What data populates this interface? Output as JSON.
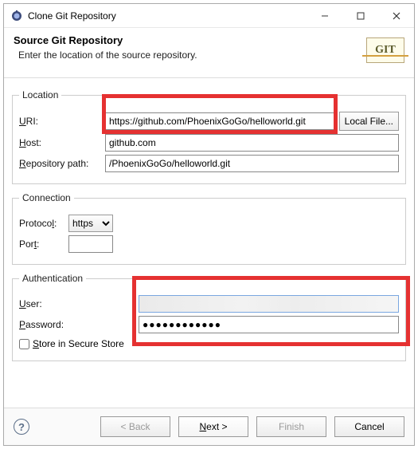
{
  "titlebar": {
    "title": "Clone Git Repository"
  },
  "header": {
    "heading": "Source Git Repository",
    "subtitle": "Enter the location of the source repository.",
    "badge": "GIT"
  },
  "location": {
    "legend": "Location",
    "uri_label": "URI:",
    "uri_value": "https://github.com/PhoenixGoGo/helloworld.git",
    "local_file_btn": "Local File...",
    "host_label": "Host:",
    "host_value": "github.com",
    "repo_label": "Repository path:",
    "repo_value": "/PhoenixGoGo/helloworld.git"
  },
  "connection": {
    "legend": "Connection",
    "protocol_label": "Protocol:",
    "protocol_value": "https",
    "port_label": "Port:",
    "port_value": ""
  },
  "auth": {
    "legend": "Authentication",
    "user_label": "User:",
    "password_label": "Password:",
    "password_value": "●●●●●●●●●●●●",
    "store_label": "Store in Secure Store"
  },
  "footer": {
    "back": "< Back",
    "next": "Next >",
    "finish": "Finish",
    "cancel": "Cancel"
  }
}
